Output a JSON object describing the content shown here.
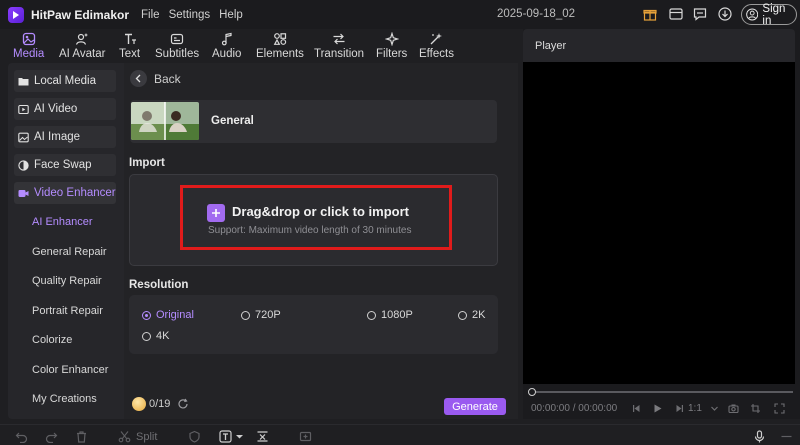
{
  "app": {
    "name": "HitPaw Edimakor",
    "menu": [
      "File",
      "Settings",
      "Help"
    ],
    "project_name": "2025-09-18_02",
    "signin_label": "Sign in",
    "title_icons": [
      "gift-icon",
      "layout-icon",
      "feedback-icon",
      "download-icon"
    ]
  },
  "toolbar": {
    "tools": [
      {
        "label": "Media",
        "icon": "media-icon",
        "active": true
      },
      {
        "label": "AI Avatar",
        "icon": "ai-avatar-icon"
      },
      {
        "label": "Text",
        "icon": "text-icon"
      },
      {
        "label": "Subtitles",
        "icon": "subtitles-icon"
      },
      {
        "label": "Audio",
        "icon": "audio-icon"
      },
      {
        "label": "Elements",
        "icon": "elements-icon"
      },
      {
        "label": "Transition",
        "icon": "transition-icon"
      },
      {
        "label": "Filters",
        "icon": "filters-icon"
      },
      {
        "label": "Effects",
        "icon": "effects-icon"
      }
    ]
  },
  "sidebar": {
    "items": [
      {
        "label": "Local Media",
        "icon": "folder-icon"
      },
      {
        "label": "AI Video",
        "icon": "ai-video-icon"
      },
      {
        "label": "AI Image",
        "icon": "ai-image-icon"
      },
      {
        "label": "Face Swap",
        "icon": "face-swap-icon"
      },
      {
        "label": "Video Enhancer",
        "icon": "video-enhancer-icon",
        "active": true
      }
    ],
    "sub_items": [
      {
        "label": "AI Enhancer",
        "active": true
      },
      {
        "label": "General Repair"
      },
      {
        "label": "Quality Repair"
      },
      {
        "label": "Portrait Repair"
      },
      {
        "label": "Colorize"
      },
      {
        "label": "Color Enhancer"
      },
      {
        "label": "My Creations"
      }
    ]
  },
  "center": {
    "back_label": "Back",
    "model_card_label": "General",
    "import_title": "Import",
    "drag_label": "Drag&drop or click to import",
    "support_label": "Support: Maximum video length of 30 minutes",
    "resolution_title": "Resolution",
    "resolutions": [
      {
        "label": "Original",
        "checked": true
      },
      {
        "label": "720P"
      },
      {
        "label": "1080P"
      },
      {
        "label": "2K"
      },
      {
        "label": "4K"
      }
    ],
    "credits": "0/19",
    "generate_label": "Generate"
  },
  "player": {
    "title": "Player",
    "timecode": "00:00:00 / 00:00:00",
    "speed": "1:1"
  },
  "bottombar": {
    "split_label": "Split"
  },
  "colors": {
    "accent": "#b48cff",
    "generate": "#9a5af0",
    "highlight": "#e01b1b"
  }
}
